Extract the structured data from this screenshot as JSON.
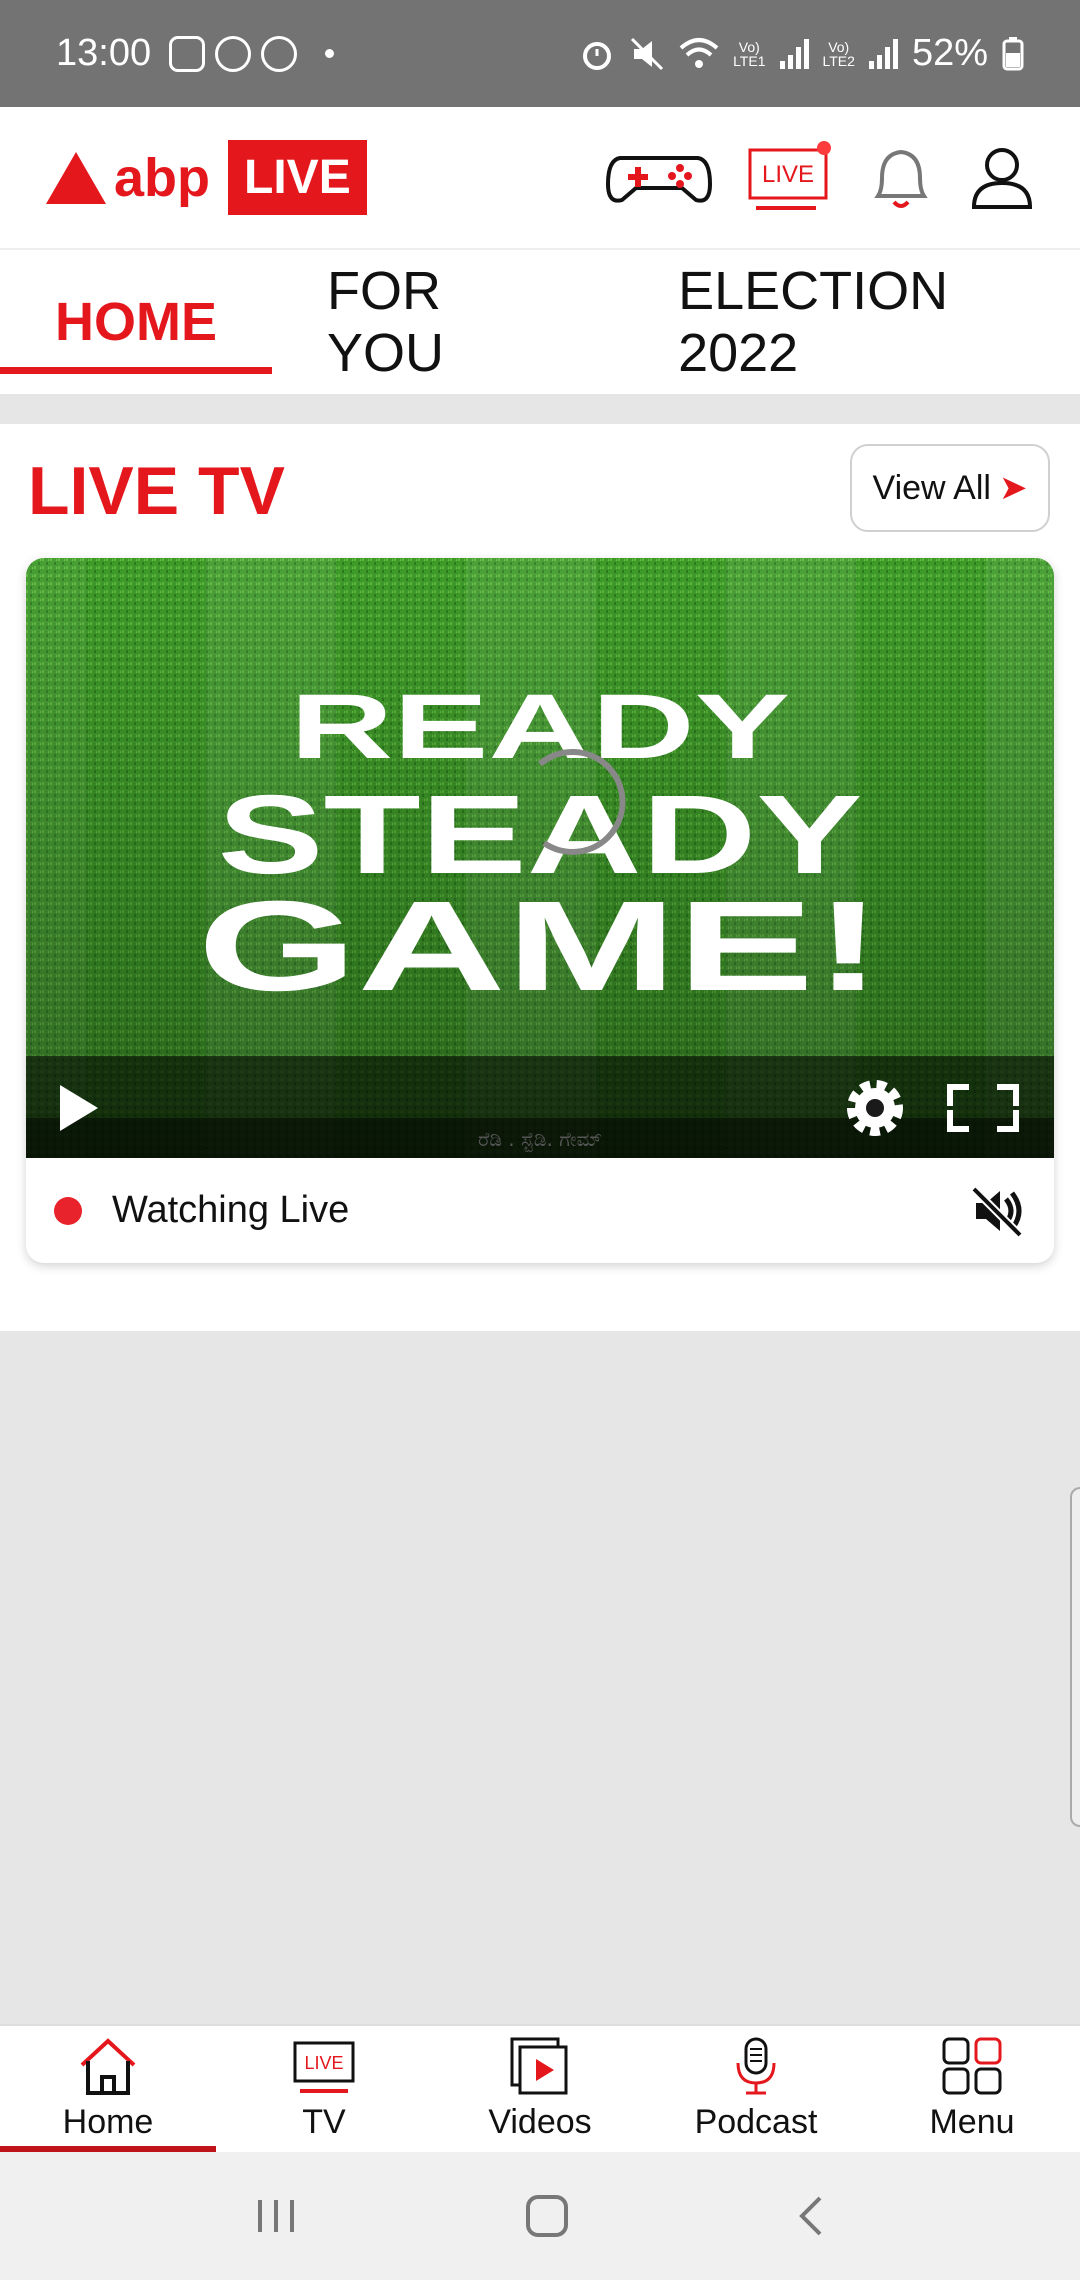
{
  "status_bar": {
    "time": "13:00",
    "lte1_label": "Vo)\nLTE1",
    "lte2_label": "Vo)\nLTE2",
    "battery": "52%"
  },
  "header": {
    "logo_abp": "abp",
    "logo_live": "LIVE",
    "live_tv_icon_label": "LIVE"
  },
  "tabs": [
    {
      "label": "HOME",
      "active": true
    },
    {
      "label": "FOR YOU",
      "active": false
    },
    {
      "label": "ELECTION 2022",
      "active": false
    }
  ],
  "live_tv": {
    "title": "LIVE TV",
    "view_all": "View All",
    "video_line1": "READY",
    "video_line2": "STEADY",
    "video_line3": "GAME!",
    "video_caption": "ರೆಡಿ . ಸ್ಟೆಡಿ. ಗೇಮ್",
    "status_text": "Watching Live"
  },
  "bottom_nav": [
    {
      "label": "Home",
      "icon": "home-icon",
      "active": true
    },
    {
      "label": "TV",
      "icon": "tv-live-icon",
      "active": false
    },
    {
      "label": "Videos",
      "icon": "videos-icon",
      "active": false
    },
    {
      "label": "Podcast",
      "icon": "podcast-icon",
      "active": false
    },
    {
      "label": "Menu",
      "icon": "menu-grid-icon",
      "active": false
    }
  ],
  "tv_nav_icon_label": "LIVE",
  "colors": {
    "brand_red": "#e4171c",
    "status_bar": "#737373",
    "page_bg": "#e6e6e6"
  }
}
